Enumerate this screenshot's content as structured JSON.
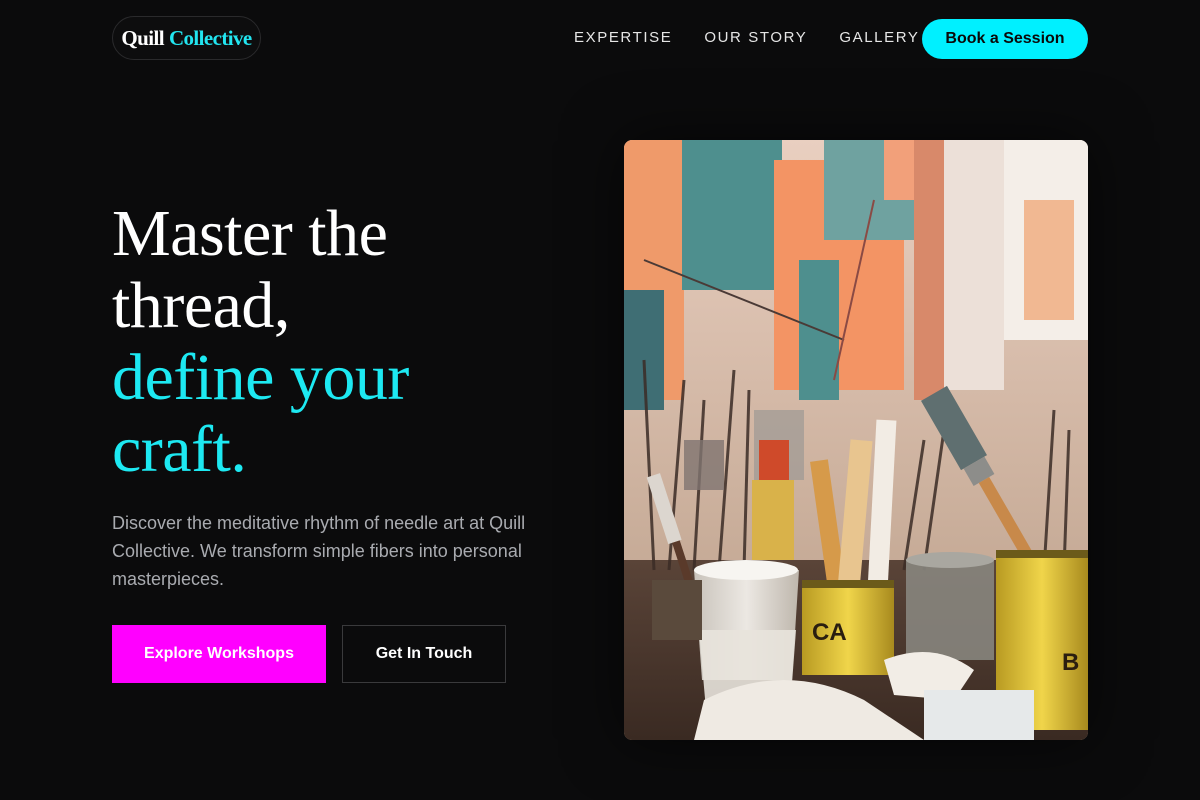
{
  "header": {
    "logo_part1": "Quill",
    "logo_part2": "Collective",
    "nav": [
      "EXPERTISE",
      "OUR STORY",
      "GALLERY"
    ],
    "cta_label": "Book a Session"
  },
  "hero": {
    "headline_lines": [
      "Master the",
      "thread,",
      "define your",
      "craft."
    ],
    "subtext": "Discover the meditative rhythm of needle art at Quill Collective. We transform simple fibers into personal masterpieces.",
    "primary_button": "Explore Workshops",
    "secondary_button": "Get In Touch",
    "image_label": "art-studio-paint-brushes-photo"
  },
  "colors": {
    "background": "#0b0b0c",
    "accent_cyan": "#00f0ff",
    "accent_magenta": "#ff00ff",
    "body_text": "#a9abb0"
  }
}
